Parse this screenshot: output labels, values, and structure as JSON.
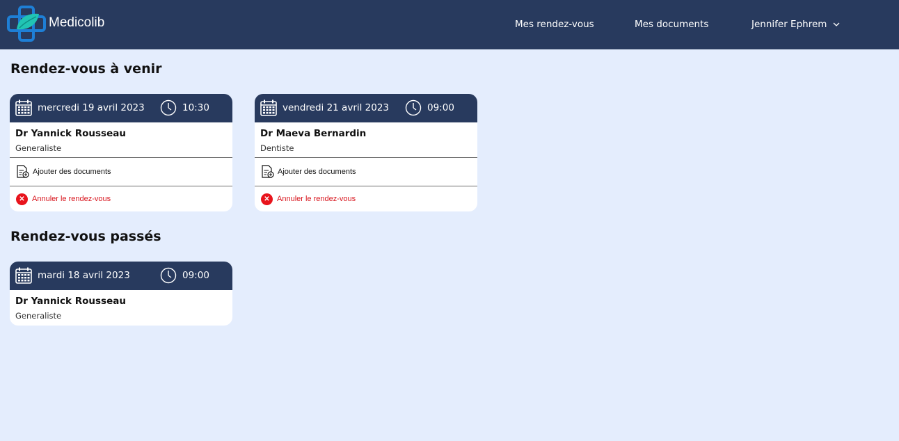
{
  "nav": {
    "brand": "Medicolib",
    "links": [
      {
        "label": "Mes rendez-vous"
      },
      {
        "label": "Mes documents"
      }
    ],
    "user": {
      "name": "Jennifer Ephrem"
    }
  },
  "sections": {
    "upcoming_title": "Rendez-vous à venir",
    "past_title": "Rendez-vous passés"
  },
  "upcoming": [
    {
      "date": "mercredi 19 avril 2023",
      "time": "10:30",
      "doctor": "Dr Yannick Rousseau",
      "specialty": "Generaliste",
      "add_docs": "Ajouter des documents",
      "cancel": "Annuler le rendez-vous"
    },
    {
      "date": "vendredi 21 avril 2023",
      "time": "09:00",
      "doctor": "Dr Maeva Bernardin",
      "specialty": "Dentiste",
      "add_docs": "Ajouter des documents",
      "cancel": "Annuler le rendez-vous"
    }
  ],
  "past": [
    {
      "date": "mardi 18 avril 2023",
      "time": "09:00",
      "doctor": "Dr Yannick Rousseau",
      "specialty": "Generaliste"
    }
  ],
  "icons": [
    "logo-cross-icon",
    "calendar-icon",
    "clock-icon",
    "document-add-icon",
    "cancel-icon",
    "chevron-down-icon"
  ],
  "colors": {
    "navbar": "#283a5e",
    "background": "#e4edfd",
    "cancel_red": "#e8141c",
    "logo_blue": "#1e7fd6",
    "logo_teal": "#21c4b4"
  }
}
